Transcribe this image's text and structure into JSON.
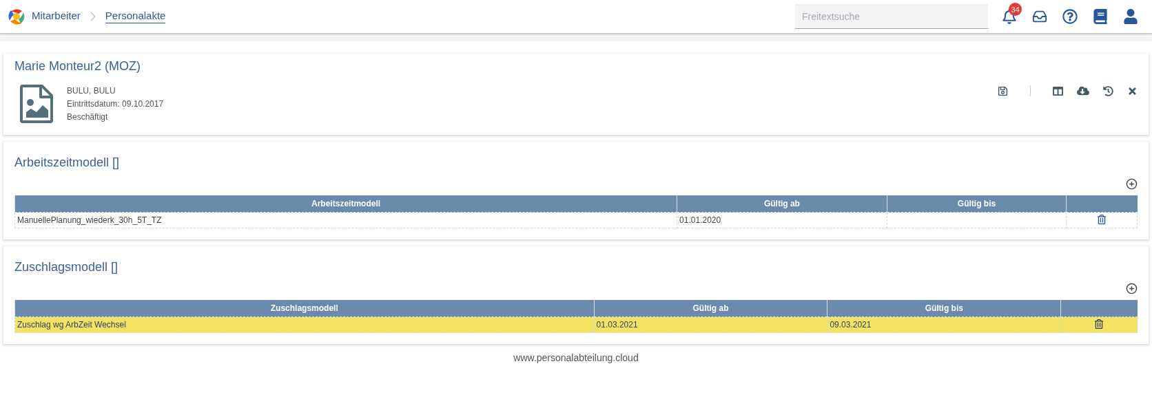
{
  "breadcrumb": [
    {
      "label": "Mitarbeiter",
      "current": false
    },
    {
      "label": "Personalakte",
      "current": true
    }
  ],
  "search": {
    "placeholder": "Freitextsuche"
  },
  "notifications": {
    "count": "34"
  },
  "employee": {
    "name": "Marie Monteur2 (MOZ)",
    "lines": [
      "BULU, BULU",
      "Eintrittsdatum: 09.10.2017",
      "Beschäftigt"
    ]
  },
  "sections": [
    {
      "title": "Arbeitszeitmodell []",
      "columns": [
        "Arbeitszeitmodell",
        "Gültig ab",
        "Gültig bis"
      ],
      "rows": [
        {
          "cells": [
            "ManuellePlanung_wiederk_30h_5T_TZ",
            "01.01.2020",
            ""
          ],
          "selected": false
        }
      ]
    },
    {
      "title": "Zuschlagsmodell []",
      "columns": [
        "Zuschlagsmodell",
        "Gültig ab",
        "Gültig bis"
      ],
      "rows": [
        {
          "cells": [
            "Zuschlag wg ArbZeit Wechsel",
            "01.03.2021",
            "09.03.2021"
          ],
          "selected": true
        }
      ]
    }
  ],
  "footer": "www.personalabteilung.cloud"
}
